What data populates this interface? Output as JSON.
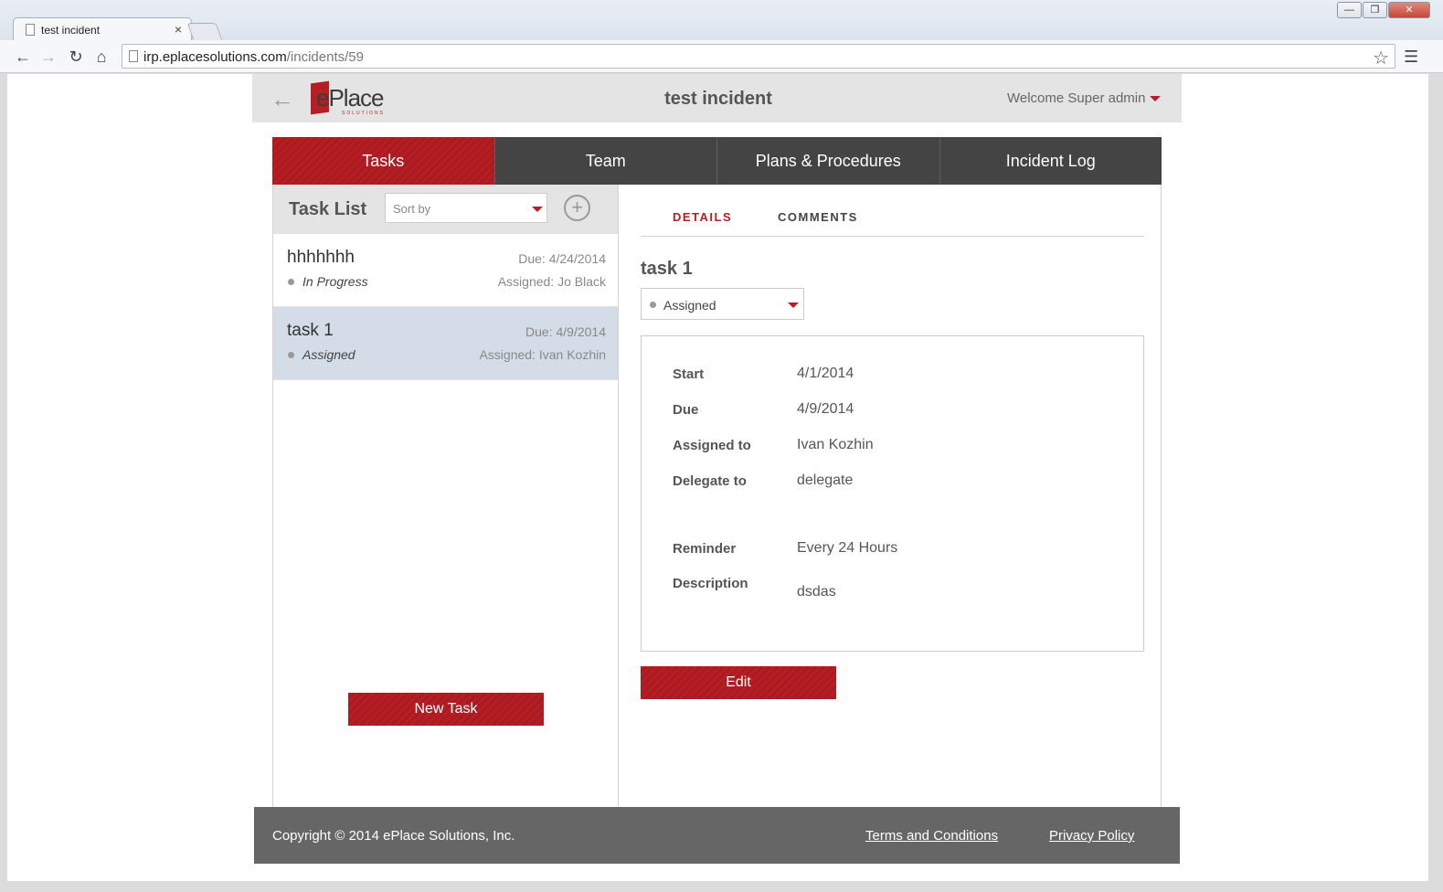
{
  "browser": {
    "tab_title": "test incident",
    "tab_close": "×",
    "url_host": "irp.eplacesolutions.com",
    "url_path": "/incidents/59",
    "window_controls": [
      "—",
      "❐",
      "✕"
    ]
  },
  "header": {
    "brand": "ePlace",
    "brand_sub": "SOLUTIONS",
    "incident_title": "test incident",
    "welcome": "Welcome Super admin"
  },
  "tabs": [
    {
      "label": "Tasks",
      "active": true
    },
    {
      "label": "Team",
      "active": false
    },
    {
      "label": "Plans & Procedures",
      "active": false
    },
    {
      "label": "Incident Log",
      "active": false
    }
  ],
  "task_list": {
    "title": "Task List",
    "sort_placeholder": "Sort by",
    "new_task_label": "New Task",
    "items": [
      {
        "name": "hhhhhhh",
        "due": "Due: 4/24/2014",
        "status": "In Progress",
        "assigned": "Assigned: Jo Black",
        "selected": false
      },
      {
        "name": "task 1",
        "due": "Due: 4/9/2014",
        "status": "Assigned",
        "assigned": "Assigned: Ivan Kozhin",
        "selected": true
      }
    ]
  },
  "details": {
    "tab_details": "DETAILS",
    "tab_comments": "COMMENTS",
    "task_title": "task 1",
    "status": "Assigned",
    "fields": {
      "start_label": "Start",
      "start": "4/1/2014",
      "due_label": "Due",
      "due": "4/9/2014",
      "assigned_label": "Assigned to",
      "assigned": "Ivan Kozhin",
      "delegate_label": "Delegate to",
      "delegate": "delegate",
      "reminder_label": "Reminder",
      "reminder": "Every 24 Hours",
      "description_label": "Description",
      "description": "dsdas"
    },
    "edit_label": "Edit"
  },
  "footer": {
    "copyright": "Copyright © 2014 ePlace Solutions, Inc.",
    "terms": "Terms and Conditions",
    "privacy": "Privacy Policy"
  },
  "colors": {
    "brand_red": "#b51f24",
    "nav_dark": "#444444",
    "selected_row": "#d4dce8"
  }
}
